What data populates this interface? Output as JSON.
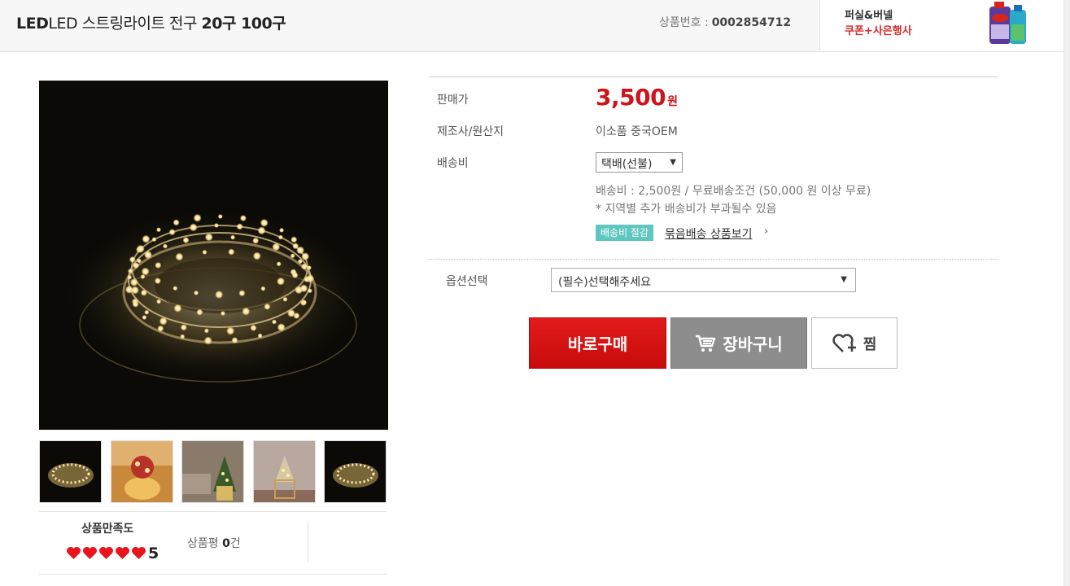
{
  "header": {
    "title_prefix": "LED 스트링라이트 전구 ",
    "title_suffix": "20구 100구",
    "product_no_label": "상품번호 :",
    "product_no": "0002854712",
    "promo_line1": "퍼실&버넬",
    "promo_line2": "쿠폰+사은행사"
  },
  "gallery": {
    "thumbnails": [
      "string-light-coil",
      "cake-stand-lights",
      "tree-sofa-lights",
      "basket-tree-lights",
      "string-light-coil"
    ]
  },
  "rating": {
    "label": "상품만족도",
    "hearts": 5,
    "score": "5",
    "review_label": "상품평 ",
    "review_count": "0",
    "review_unit": "건"
  },
  "info": {
    "price_label": "판매가",
    "price": "3,500",
    "price_unit": "원",
    "maker_label": "제조사/원산지",
    "maker_value": "이소품 중국OEM",
    "shipping_label": "배송비",
    "shipping_selected": "택배(선불)",
    "shipping_note": "배송비 : 2,500원 / 무료배송조건 (50,000 원 이상 무료)",
    "shipping_note2": "* 지역별 추가 배송비가 부과될수 있음",
    "badge": "배송비 절감",
    "bundle_link": "묶음배송 상품보기",
    "option_label": "옵션선택",
    "option_placeholder": "(필수)선택해주세요"
  },
  "buttons": {
    "buy": "바로구매",
    "cart": "장바구니",
    "wish": "찜"
  },
  "colors": {
    "accent_red": "#d0121b",
    "badge_teal": "#5fc6c0",
    "heart_red": "#e8141e"
  }
}
